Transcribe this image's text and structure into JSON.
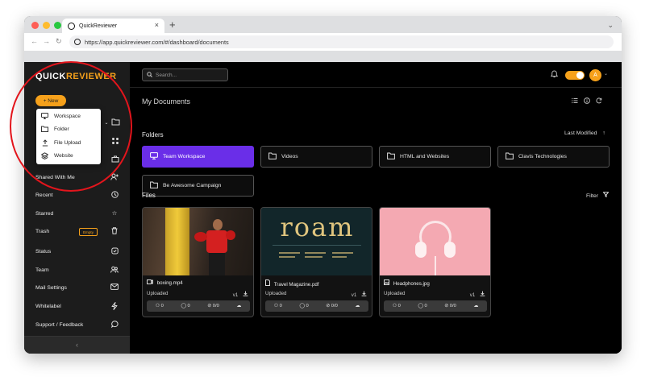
{
  "browser": {
    "tab_title": "QuickReviewer",
    "new_tab_symbol": "+",
    "close_symbol": "×",
    "url": "https://app.quickreviewer.com/#/dashboard/documents"
  },
  "app": {
    "logo_part1": "QUICK",
    "logo_part2": "REVIEWER",
    "brand_color": "#f6a11b",
    "new_button": "+ New",
    "search_placeholder": "Search...",
    "avatar_letter": "A"
  },
  "new_menu": {
    "items": [
      {
        "label": "Workspace",
        "icon": "monitor-icon"
      },
      {
        "label": "Folder",
        "icon": "folder-icon"
      },
      {
        "label": "File Upload",
        "icon": "upload-icon"
      },
      {
        "label": "Website",
        "icon": "layers-icon"
      }
    ]
  },
  "sidebar": {
    "items": [
      {
        "label": "Shared With Me",
        "icon": "user-plus-icon"
      },
      {
        "label": "Recent",
        "icon": "clock-icon"
      },
      {
        "label": "Starred",
        "icon": "star-icon"
      },
      {
        "label": "Trash",
        "icon": "trash-icon",
        "badge": "Empty"
      },
      {
        "label": "Status",
        "icon": "shield-icon"
      },
      {
        "label": "Team",
        "icon": "users-icon"
      },
      {
        "label": "Mail Settings",
        "icon": "mail-icon"
      },
      {
        "label": "Whitelabel",
        "icon": "bolt-icon"
      },
      {
        "label": "Support / Feedback",
        "icon": "chat-icon"
      }
    ],
    "collapse_symbol": "‹"
  },
  "main": {
    "title": "My Documents",
    "folders_heading": "Folders",
    "sort_label": "Last Modified",
    "files_heading": "Files",
    "filter_label": "Filter",
    "folders": [
      {
        "name": "Team Workspace",
        "active": true
      },
      {
        "name": "Videos"
      },
      {
        "name": "HTML and Websites"
      },
      {
        "name": "Clavis Technologies"
      },
      {
        "name": "Be Awesome Campaign"
      }
    ],
    "files": [
      {
        "name": "boxing.mp4",
        "type_icon": "video-icon",
        "status": "Uploaded",
        "version": "v1",
        "viewers": "0",
        "comments": "0",
        "approvals": "0/0"
      },
      {
        "name": "Travel Magazine.pdf",
        "type_icon": "document-icon",
        "status": "Uploaded",
        "version": "v1",
        "viewers": "0",
        "comments": "0",
        "approvals": "0/0"
      },
      {
        "name": "Headphones.jpg",
        "type_icon": "image-icon",
        "status": "Uploaded",
        "version": "v1",
        "viewers": "0",
        "comments": "0",
        "approvals": "0/0"
      }
    ],
    "magazine_word": "roam"
  }
}
